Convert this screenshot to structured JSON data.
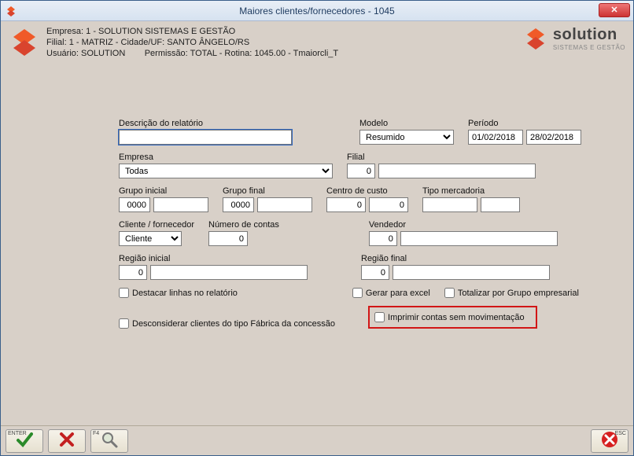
{
  "titlebar": {
    "title": "Maiores clientes/fornecedores - 1045",
    "close_glyph": "✕"
  },
  "header": {
    "line1_lbl": "Empresa:",
    "line1_val": "1 - SOLUTION SISTEMAS E GESTÃO",
    "line2_lbl": "Filial:",
    "line2_val": "1 - MATRIZ - Cidade/UF: SANTO ÂNGELO/RS",
    "line3_lbl": "Usuário:",
    "line3_val": "SOLUTION",
    "line3_perm_lbl": "Permissão:",
    "line3_perm_val": "TOTAL - Rotina: 1045.00 - Tmaiorcli_T",
    "logo_text": "solution",
    "logo_sub": "SISTEMAS E GESTÃO"
  },
  "fields": {
    "descricao_lbl": "Descrição do relatório",
    "descricao_val": "",
    "modelo_lbl": "Modelo",
    "modelo_val": "Resumido",
    "periodo_lbl": "Período",
    "periodo_from": "01/02/2018",
    "periodo_to": "28/02/2018",
    "empresa_lbl": "Empresa",
    "empresa_val": "Todas",
    "filial_lbl": "Filial",
    "filial_code": "0",
    "filial_name": "",
    "grupo_ini_lbl": "Grupo inicial",
    "grupo_ini_code": "0000",
    "grupo_ini_name": "",
    "grupo_fim_lbl": "Grupo final",
    "grupo_fim_code": "0000",
    "grupo_fim_name": "",
    "centro_lbl": "Centro de custo",
    "centro_a": "0",
    "centro_b": "0",
    "tipo_merc_lbl": "Tipo mercadoria",
    "tipo_merc_a": "",
    "tipo_merc_b": "",
    "cliforn_lbl": "Cliente / fornecedor",
    "cliforn_val": "Cliente",
    "ncontas_lbl": "Número de contas",
    "ncontas_val": "0",
    "vendedor_lbl": "Vendedor",
    "vendedor_code": "0",
    "vendedor_name": "",
    "regiao_ini_lbl": "Região inicial",
    "regiao_ini_code": "0",
    "regiao_ini_name": "",
    "regiao_fim_lbl": "Região final",
    "regiao_fim_code": "0",
    "regiao_fim_name": ""
  },
  "checks": {
    "destacar": "Destacar linhas no relatório",
    "gerar_excel": "Gerar para excel",
    "totalizar": "Totalizar por Grupo empresarial",
    "desconsiderar": "Desconsiderar clientes do tipo Fábrica da concessão",
    "imprimir_sem_mov": "Imprimir contas sem movimentação"
  },
  "footer": {
    "enter_kbd": "ENTER",
    "f4_kbd": "F4",
    "esc_kbd": "ESC"
  },
  "colors": {
    "highlight": "#d21616",
    "titlebar_text": "#1d3a5f",
    "bg": "#d8d0c8",
    "brand": "#f05a28"
  }
}
